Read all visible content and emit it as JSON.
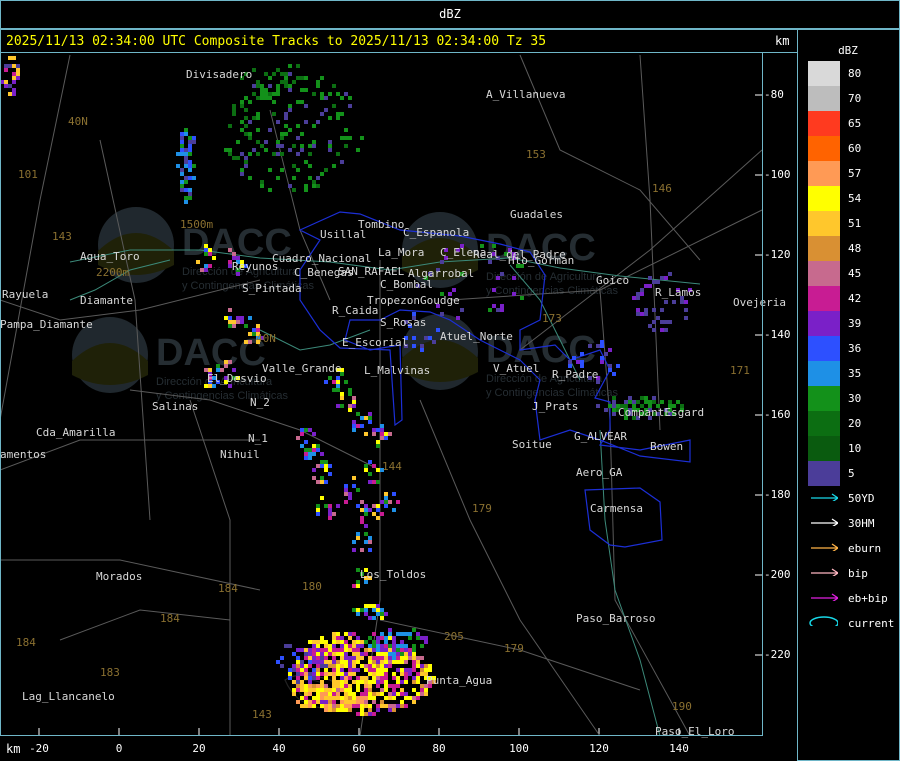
{
  "window": {
    "units_title": "dBZ"
  },
  "map": {
    "title": "2025/11/13 02:34:00 UTC Composite Tracks to 2025/11/13 02:34:00 Tz 35",
    "km_label_top": "km",
    "km_label_bottom": "km",
    "watermark": {
      "brand": "DACC",
      "line1": "Dirección de Agricultura",
      "line2": "y Contingencias Climáticas"
    },
    "places": [
      "Divisadero",
      "A_Villanueva",
      "Guadales",
      "Tombino",
      "Usillal",
      "C_Espanola",
      "La_Mora",
      "C_Elena",
      "Goico",
      "Agua_Toro",
      "R_Lamos",
      "Ovejeria",
      "Rayuela",
      "Diamante",
      "Pampa_Diamante",
      "Reyunos",
      "S_Pintada",
      "C_Benegas",
      "SAN_RAFAEL",
      "Algarrobal",
      "C_Bombal",
      "Cuadro_Nacional",
      "Real_del_Padre",
      "Hto_Gorman",
      "R_Caida",
      "Tropezon",
      "Goudge",
      "S_Rosas",
      "Atuel_Norte",
      "E_Escorial",
      "El_Desvio",
      "Valle_Grande",
      "L_Malvinas",
      "V_Atuel",
      "R_Padre",
      "Salinas",
      "N_2",
      "J_Prats",
      "CompantEsgard",
      "Cda_Amarilla",
      "N_1",
      "G_ALVEAR",
      "Bowen",
      "Soitue",
      "amentos",
      "Nihuil",
      "Aero_GA",
      "Carmensa",
      "Los_Toldos",
      "Morados",
      "Paso_Barroso",
      "Punta_Agua",
      "Lag_Llancanelo",
      "Paso_El_Loro"
    ],
    "route_numbers": [
      "40N",
      "101",
      "153",
      "146",
      "143",
      "40N",
      "144",
      "173",
      "171",
      "205",
      "179",
      "184",
      "180",
      "184",
      "183",
      "184",
      "179",
      "190",
      "143",
      "2200m",
      "1500m"
    ],
    "y_ticks": [
      -80,
      -100,
      -120,
      -140,
      -160,
      -180,
      -200,
      -220
    ],
    "x_ticks": [
      -20,
      0,
      20,
      40,
      60,
      80,
      100,
      120,
      140
    ]
  },
  "legend": {
    "title": "dBZ",
    "levels": [
      {
        "value": "80",
        "color": "#d9d9d9"
      },
      {
        "value": "70",
        "color": "#bdbdbd"
      },
      {
        "value": "65",
        "color": "#ff3a1f"
      },
      {
        "value": "60",
        "color": "#ff6300"
      },
      {
        "value": "57",
        "color": "#ff9a55"
      },
      {
        "value": "54",
        "color": "#ffff00"
      },
      {
        "value": "51",
        "color": "#ffc72c"
      },
      {
        "value": "48",
        "color": "#d99033"
      },
      {
        "value": "45",
        "color": "#c76a8e"
      },
      {
        "value": "42",
        "color": "#c81c93"
      },
      {
        "value": "39",
        "color": "#7a20c8"
      },
      {
        "value": "36",
        "color": "#2d50ff"
      },
      {
        "value": "35",
        "color": "#1e90e6"
      },
      {
        "value": "30",
        "color": "#13911a"
      },
      {
        "value": "20",
        "color": "#0c6e12"
      },
      {
        "value": "10",
        "color": "#0a5b0f"
      },
      {
        "value": "5",
        "color": "#4b3d99"
      }
    ],
    "tracks": [
      {
        "label": "50YD",
        "color": "#18d8e8",
        "type": "arrow"
      },
      {
        "label": "30HM",
        "color": "#ffffff",
        "type": "arrow"
      },
      {
        "label": "eburn",
        "color": "#ffb347",
        "type": "arrow"
      },
      {
        "label": "bip",
        "color": "#ffb6c1",
        "type": "arrow"
      },
      {
        "label": "eb+bip",
        "color": "#e020e0",
        "type": "arrow"
      },
      {
        "label": "current",
        "color": "#18d8e8",
        "type": "ellipse"
      }
    ]
  }
}
